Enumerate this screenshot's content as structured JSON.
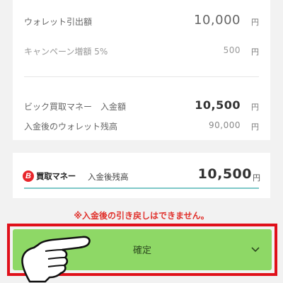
{
  "summary": {
    "wallet_withdraw_label": "ウォレット引出額",
    "wallet_withdraw_value": "10,000",
    "campaign_bonus_label": "キャンペーン増額 5%",
    "campaign_bonus_value": "500",
    "bic_deposit_label": "ビック買取マネー　入金額",
    "bic_deposit_value": "10,500",
    "wallet_balance_after_label": "入金後のウォレット残高",
    "wallet_balance_after_value": "90,000",
    "unit": "円"
  },
  "balance_card": {
    "logo_mark": "B",
    "logo_text": "買取マネー",
    "label": "入金後残高",
    "value": "10,500",
    "unit": "円"
  },
  "warning_text": "※入金後の引き戻しはできません。",
  "confirm_button": {
    "label": "確定",
    "icon": "chevron-down-icon"
  },
  "colors": {
    "button": "#8ed866",
    "highlight_frame": "#e0101a",
    "warning": "#e0302b",
    "logo": "#e8262b",
    "underline": "#7fc8c8"
  },
  "pointer_icon": "pointing-hand-icon"
}
